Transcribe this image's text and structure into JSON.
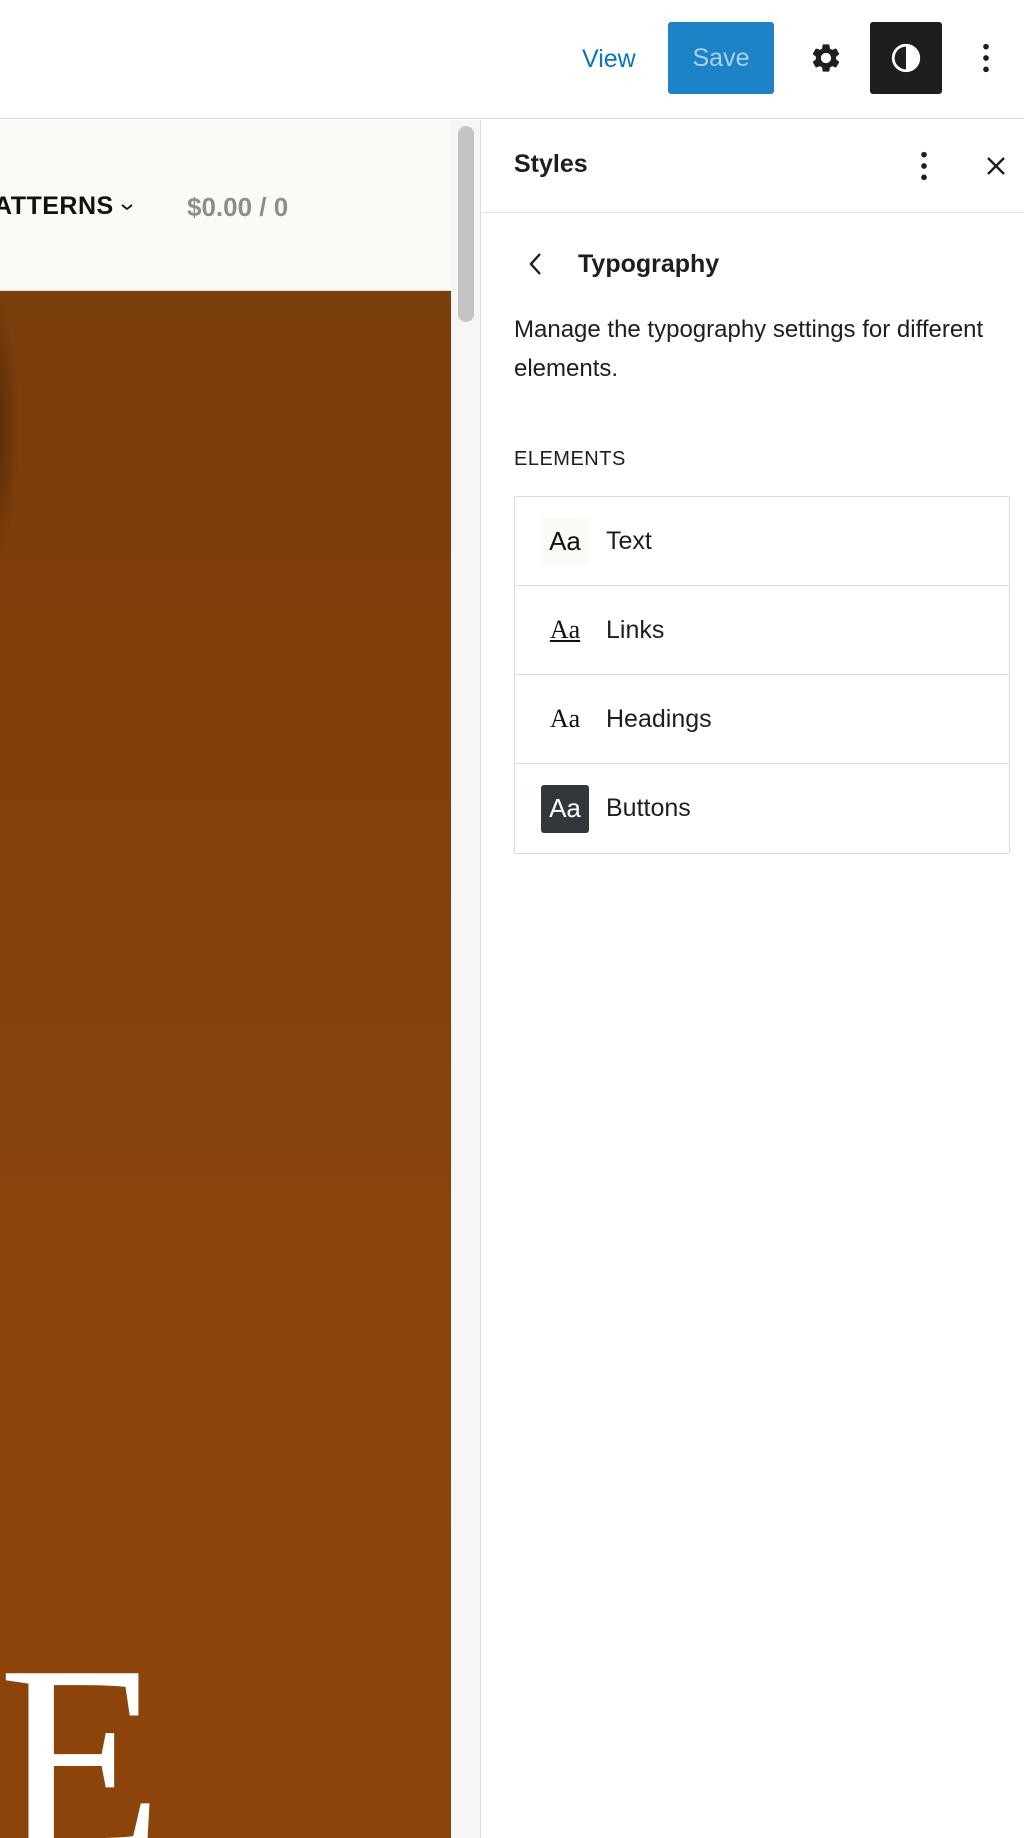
{
  "toolbar": {
    "view_label": "View",
    "save_label": "Save",
    "settings_icon": "gear-icon",
    "styles_icon": "half-circle-contrast-icon",
    "more_icon": "vertical-ellipsis-icon"
  },
  "canvas": {
    "nav_patterns": "ATTERNS",
    "nav_cart": "$0.00 / 0",
    "hero_letter": "E",
    "hero_color": "#86420b"
  },
  "panel": {
    "title": "Styles",
    "screen_title": "Typography",
    "description": "Manage the typography settings for different elements.",
    "section_label": "ELEMENTS",
    "elements": [
      {
        "preview": "Aa",
        "label": "Text"
      },
      {
        "preview": "Aa",
        "label": "Links"
      },
      {
        "preview": "Aa",
        "label": "Headings"
      },
      {
        "preview": "Aa",
        "label": "Buttons"
      }
    ]
  },
  "colors": {
    "accent": "#1e83c6",
    "link": "#0a75b9",
    "dark": "#1e1e1e"
  }
}
